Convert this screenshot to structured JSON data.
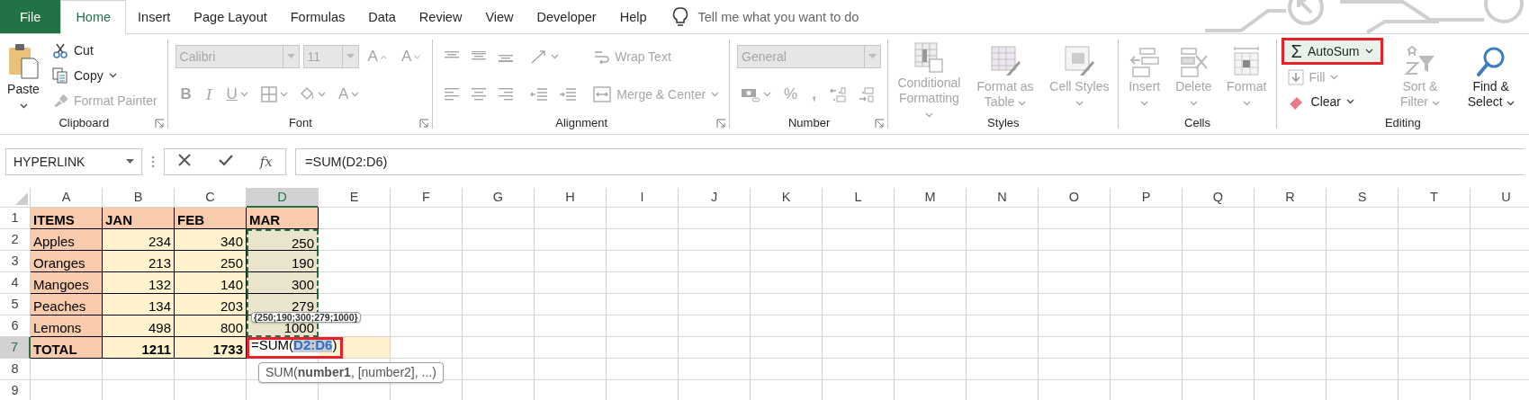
{
  "menu_tabs": [
    {
      "label": "File",
      "kind": "file",
      "selected": false
    },
    {
      "label": "Home",
      "kind": "tab",
      "selected": true
    },
    {
      "label": "Insert",
      "kind": "tab",
      "selected": false
    },
    {
      "label": "Page Layout",
      "kind": "tab",
      "selected": false
    },
    {
      "label": "Formulas",
      "kind": "tab",
      "selected": false
    },
    {
      "label": "Data",
      "kind": "tab",
      "selected": false
    },
    {
      "label": "Review",
      "kind": "tab",
      "selected": false
    },
    {
      "label": "View",
      "kind": "tab",
      "selected": false
    },
    {
      "label": "Developer",
      "kind": "tab",
      "selected": false
    },
    {
      "label": "Help",
      "kind": "tab",
      "selected": false
    }
  ],
  "tell_me": {
    "placeholder": "Tell me what you want to do"
  },
  "ribbon": [
    {
      "name": "Clipboard",
      "launcher": true,
      "columns": [
        [
          [
            {
              "kind": "large",
              "label": "Paste",
              "dropdown": true,
              "disabled": false
            }
          ]
        ],
        [
          [
            {
              "kind": "small",
              "label": "Cut",
              "dropdown": false,
              "disabled": false
            }
          ],
          [
            {
              "kind": "small",
              "label": "Copy",
              "dropdown": true,
              "disabled": false
            }
          ],
          [
            {
              "kind": "small",
              "label": "Format Painter",
              "dropdown": false,
              "disabled": true
            }
          ]
        ]
      ]
    },
    {
      "name": "Font",
      "launcher": true,
      "columns": [
        [
          [
            {
              "kind": "combo",
              "label": "Calibri",
              "disabled": true
            },
            {
              "kind": "combo",
              "label": "11",
              "disabled": true
            },
            {
              "kind": "glyph",
              "label": "A",
              "dropdown": false,
              "disabled": true
            },
            {
              "kind": "glyph",
              "label": "A",
              "dropdown": false,
              "disabled": true
            }
          ],
          [
            {
              "kind": "glyph",
              "label": "B",
              "dropdown": false,
              "disabled": true
            },
            {
              "kind": "glyph",
              "label": "I",
              "dropdown": false,
              "disabled": true
            },
            {
              "kind": "glyph",
              "label": "U",
              "dropdown": true,
              "disabled": true
            },
            {
              "kind": "icon",
              "dropdown": true,
              "disabled": true
            },
            {
              "kind": "icon",
              "dropdown": true,
              "disabled": true
            },
            {
              "kind": "glyph",
              "label": "A",
              "dropdown": true,
              "disabled": true
            }
          ]
        ]
      ]
    },
    {
      "name": "Alignment",
      "launcher": true,
      "columns": [
        [
          [
            {
              "kind": "icon",
              "dropdown": false,
              "disabled": true
            },
            {
              "kind": "icon",
              "dropdown": false,
              "disabled": true
            },
            {
              "kind": "icon",
              "dropdown": false,
              "disabled": true
            }
          ],
          [
            {
              "kind": "icon",
              "dropdown": false,
              "disabled": true
            },
            {
              "kind": "icon",
              "dropdown": false,
              "disabled": true
            },
            {
              "kind": "icon",
              "dropdown": false,
              "disabled": true
            }
          ]
        ],
        [
          [
            {
              "kind": "icon",
              "dropdown": true,
              "disabled": true
            }
          ],
          [
            {
              "kind": "icon",
              "dropdown": false,
              "disabled": true
            },
            {
              "kind": "icon",
              "dropdown": false,
              "disabled": true
            }
          ]
        ],
        [
          [
            {
              "kind": "small",
              "label": "Wrap Text",
              "dropdown": false,
              "disabled": true
            }
          ],
          [
            {
              "kind": "small",
              "label": "Merge & Center",
              "dropdown": true,
              "disabled": true
            }
          ]
        ]
      ]
    },
    {
      "name": "Number",
      "launcher": true,
      "columns": [
        [
          [
            {
              "kind": "combo",
              "label": "General",
              "disabled": true
            }
          ],
          [
            {
              "kind": "icon",
              "dropdown": true,
              "disabled": true
            },
            {
              "kind": "glyph",
              "label": "%",
              "dropdown": false,
              "disabled": true
            },
            {
              "kind": "glyph",
              "label": ",",
              "dropdown": false,
              "disabled": true
            },
            {
              "kind": "icon",
              "dropdown": false,
              "disabled": true
            },
            {
              "kind": "icon",
              "dropdown": false,
              "disabled": true
            }
          ]
        ]
      ]
    },
    {
      "name": "Styles",
      "launcher": false,
      "columns": [
        [
          [
            {
              "kind": "large",
              "label": "Conditional Formatting",
              "dropdown": true,
              "disabled": true
            }
          ]
        ],
        [
          [
            {
              "kind": "large",
              "label": "Format as Table",
              "dropdown": true,
              "disabled": true
            }
          ]
        ],
        [
          [
            {
              "kind": "large",
              "label": "Cell Styles",
              "dropdown": true,
              "disabled": true
            }
          ]
        ]
      ]
    },
    {
      "name": "Cells",
      "launcher": false,
      "columns": [
        [
          [
            {
              "kind": "large",
              "label": "Insert",
              "dropdown": true,
              "disabled": true
            }
          ]
        ],
        [
          [
            {
              "kind": "large",
              "label": "Delete",
              "dropdown": true,
              "disabled": true
            }
          ]
        ],
        [
          [
            {
              "kind": "large",
              "label": "Format",
              "dropdown": true,
              "disabled": true
            }
          ]
        ]
      ]
    },
    {
      "name": "Editing",
      "launcher": false,
      "columns": [
        [
          [
            {
              "kind": "small",
              "glyph": "Σ",
              "label": "AutoSum",
              "dropdown": true,
              "disabled": false,
              "highlighted": true
            }
          ],
          [
            {
              "kind": "small",
              "label": "Fill",
              "dropdown": true,
              "disabled": true
            }
          ],
          [
            {
              "kind": "small",
              "label": "Clear",
              "dropdown": true,
              "disabled": false
            }
          ]
        ],
        [
          [
            {
              "kind": "large",
              "label": "Sort & Filter",
              "dropdown": true,
              "disabled": true
            }
          ]
        ],
        [
          [
            {
              "kind": "large",
              "label": "Find & Select",
              "dropdown": true,
              "disabled": false
            }
          ]
        ]
      ]
    }
  ],
  "formula_bar": {
    "name_box": "HYPERLINK",
    "insert_function": "fx",
    "formula": "=SUM(D2:D6)"
  },
  "sheet": {
    "columns": [
      {
        "label": "A",
        "selected": false
      },
      {
        "label": "B",
        "selected": false
      },
      {
        "label": "C",
        "selected": false
      },
      {
        "label": "D",
        "selected": true
      },
      {
        "label": "E",
        "selected": false
      },
      {
        "label": "F",
        "selected": false
      },
      {
        "label": "G",
        "selected": false
      },
      {
        "label": "H",
        "selected": false
      },
      {
        "label": "I",
        "selected": false
      },
      {
        "label": "J",
        "selected": false
      },
      {
        "label": "K",
        "selected": false
      },
      {
        "label": "L",
        "selected": false
      },
      {
        "label": "M",
        "selected": false
      },
      {
        "label": "N",
        "selected": false
      },
      {
        "label": "O",
        "selected": false
      },
      {
        "label": "P",
        "selected": false
      },
      {
        "label": "Q",
        "selected": false
      },
      {
        "label": "R",
        "selected": false
      },
      {
        "label": "S",
        "selected": false
      },
      {
        "label": "T",
        "selected": false
      },
      {
        "label": "U",
        "selected": false
      }
    ],
    "rows": [
      {
        "label": "1",
        "selected": false,
        "cells": [
          {
            "value": "ITEMS",
            "kind": "text",
            "bold": true,
            "color": "#f8cbad",
            "bordered": true
          },
          {
            "value": "JAN",
            "kind": "text",
            "bold": true,
            "color": "#f8cbad",
            "bordered": true
          },
          {
            "value": "FEB",
            "kind": "text",
            "bold": true,
            "color": "#f8cbad",
            "bordered": true
          },
          {
            "value": "MAR",
            "kind": "text",
            "bold": true,
            "color": "#f8cbad",
            "bordered": true
          }
        ]
      },
      {
        "label": "2",
        "selected": false,
        "cells": [
          {
            "value": "Apples",
            "kind": "text",
            "bold": false,
            "color": "#f8cbad",
            "bordered": true
          },
          {
            "value": "234",
            "kind": "number",
            "bold": false,
            "color": "#fff2cc",
            "bordered": true
          },
          {
            "value": "340",
            "kind": "number",
            "bold": false,
            "color": "#fff2cc",
            "bordered": true
          },
          {
            "value": "250",
            "kind": "number",
            "bold": false,
            "color": "#e9e4cb",
            "bordered": true,
            "in_range": true
          }
        ]
      },
      {
        "label": "3",
        "selected": false,
        "cells": [
          {
            "value": "Oranges",
            "kind": "text",
            "bold": false,
            "color": "#f8cbad",
            "bordered": true
          },
          {
            "value": "213",
            "kind": "number",
            "bold": false,
            "color": "#fff2cc",
            "bordered": true
          },
          {
            "value": "250",
            "kind": "number",
            "bold": false,
            "color": "#fff2cc",
            "bordered": true
          },
          {
            "value": "190",
            "kind": "number",
            "bold": false,
            "color": "#e9e4cb",
            "bordered": true,
            "in_range": true
          }
        ]
      },
      {
        "label": "4",
        "selected": false,
        "cells": [
          {
            "value": "Mangoes",
            "kind": "text",
            "bold": false,
            "color": "#f8cbad",
            "bordered": true
          },
          {
            "value": "132",
            "kind": "number",
            "bold": false,
            "color": "#fff2cc",
            "bordered": true
          },
          {
            "value": "140",
            "kind": "number",
            "bold": false,
            "color": "#fff2cc",
            "bordered": true
          },
          {
            "value": "300",
            "kind": "number",
            "bold": false,
            "color": "#e9e4cb",
            "bordered": true,
            "in_range": true
          }
        ]
      },
      {
        "label": "5",
        "selected": false,
        "cells": [
          {
            "value": "Peaches",
            "kind": "text",
            "bold": false,
            "color": "#f8cbad",
            "bordered": true
          },
          {
            "value": "134",
            "kind": "number",
            "bold": false,
            "color": "#fff2cc",
            "bordered": true
          },
          {
            "value": "203",
            "kind": "number",
            "bold": false,
            "color": "#fff2cc",
            "bordered": true
          },
          {
            "value": "279",
            "kind": "number",
            "bold": false,
            "color": "#e9e4cb",
            "bordered": true,
            "in_range": true
          }
        ]
      },
      {
        "label": "6",
        "selected": false,
        "cells": [
          {
            "value": "Lemons",
            "kind": "text",
            "bold": false,
            "color": "#f8cbad",
            "bordered": true
          },
          {
            "value": "498",
            "kind": "number",
            "bold": false,
            "color": "#fff2cc",
            "bordered": true
          },
          {
            "value": "800",
            "kind": "number",
            "bold": false,
            "color": "#fff2cc",
            "bordered": true
          },
          {
            "value": "1000",
            "kind": "number",
            "bold": false,
            "color": "#e9e4cb",
            "bordered": true,
            "in_range": true
          }
        ]
      },
      {
        "label": "7",
        "selected": true,
        "cells": [
          {
            "value": "TOTAL",
            "kind": "text",
            "bold": true,
            "color": "#f8cbad",
            "bordered": true
          },
          {
            "value": "1211",
            "kind": "number",
            "bold": true,
            "color": "#fff2cc",
            "bordered": true
          },
          {
            "value": "1733",
            "kind": "number",
            "bold": true,
            "color": "#fff2cc",
            "bordered": true
          },
          {
            "kind": "formula",
            "bold": false,
            "bordered": true,
            "highlighted": true,
            "parts": [
              {
                "text": "=SUM(",
                "kind": "text"
              },
              {
                "text": "D2:D6",
                "kind": "reference"
              },
              {
                "text": ")",
                "kind": "text"
              }
            ]
          },
          {
            "kind": "text",
            "color": "#fff2cc",
            "bordered": false
          }
        ]
      },
      {
        "label": "8",
        "selected": false,
        "cells": []
      },
      {
        "label": "9",
        "selected": false,
        "cells": []
      }
    ],
    "range_tooltip": "{250;190;300;279;1000}",
    "function_tooltip": "SUM(**number1**, [number2], ...)"
  }
}
